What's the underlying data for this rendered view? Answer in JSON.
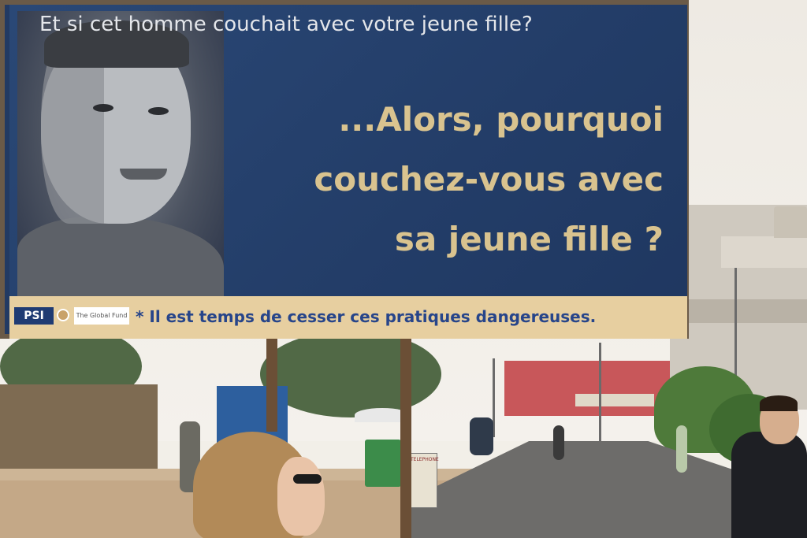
{
  "billboard": {
    "top_line": "Et si cet homme couchait avec votre jeune fille?",
    "main_lines": [
      "...Alors, pourquoi",
      "couchez-vous avec",
      "sa jeune fille ?"
    ],
    "footer": "* Il est temps de cesser ces pratiques dangereuses.",
    "logos": {
      "psi": "PSI",
      "global_fund": "The Global Fund"
    }
  },
  "street_sign": {
    "text": "TELEPHONE"
  },
  "colors": {
    "board_blue": "#223a63",
    "headline_gold": "#d9c38f",
    "footer_band": "#e7cfa0",
    "footer_text": "#27458a"
  }
}
